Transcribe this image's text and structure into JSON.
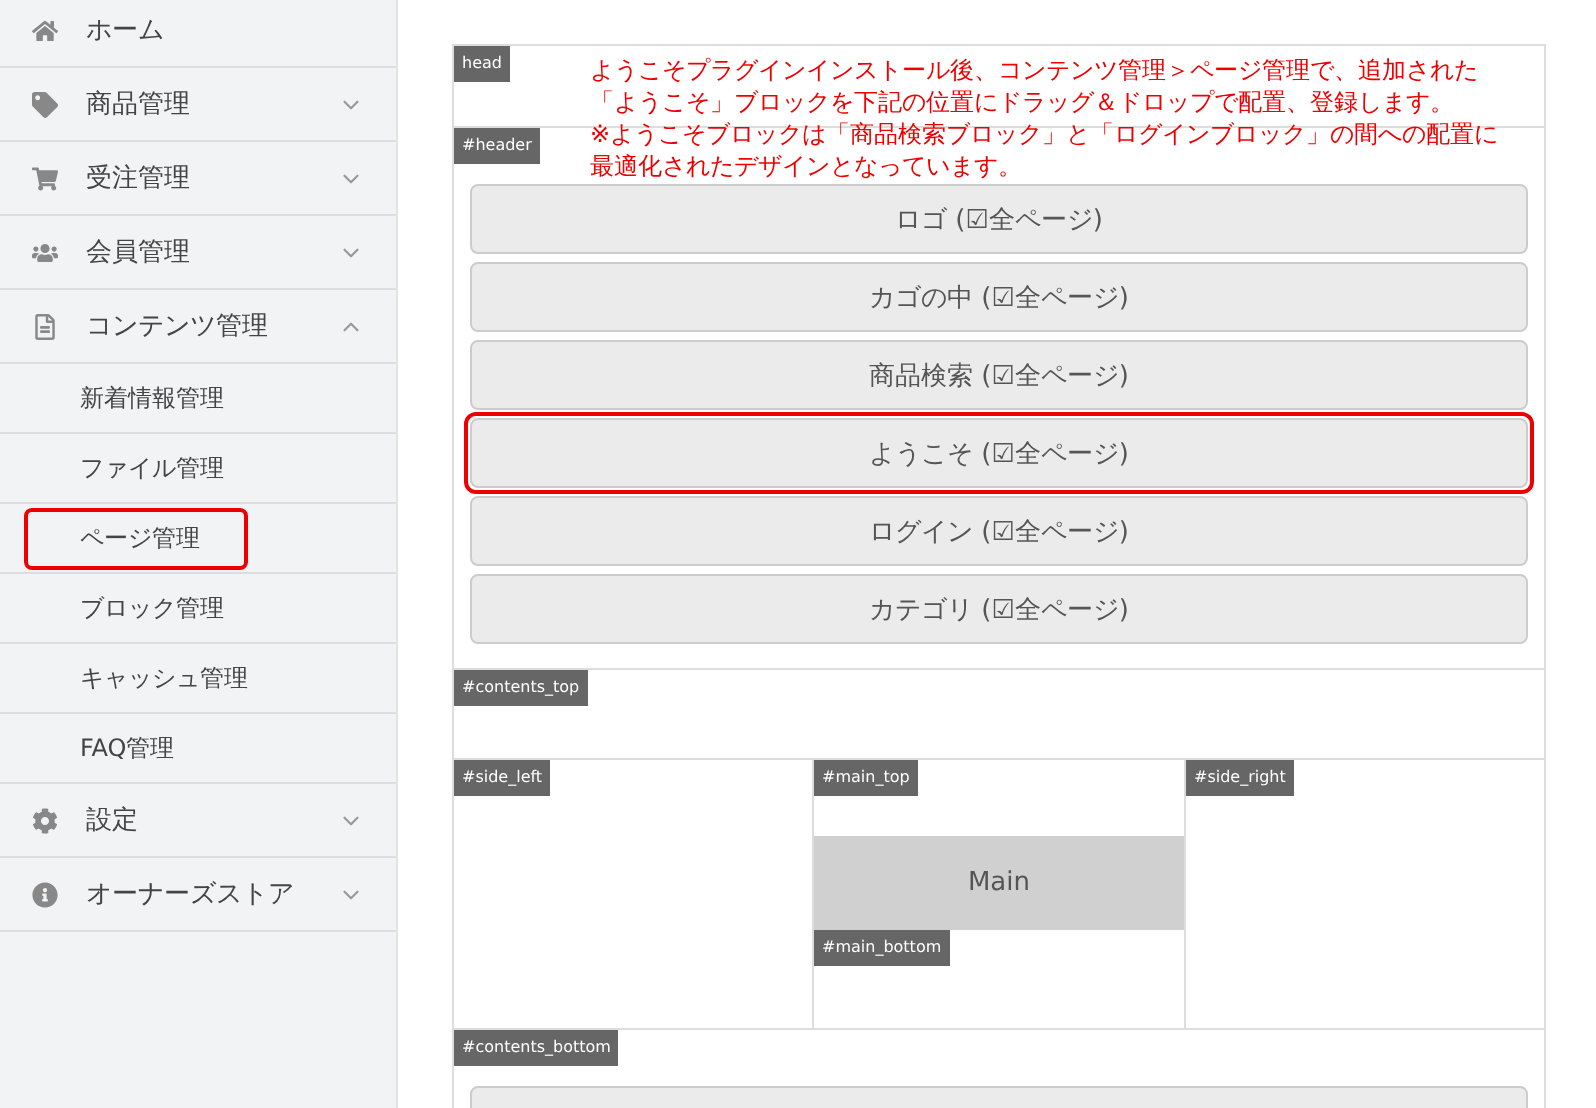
{
  "sidebar": {
    "items": [
      {
        "kind": "link",
        "label": "ホーム"
      },
      {
        "kind": "group",
        "label": "商品管理",
        "expanded": false
      },
      {
        "kind": "group",
        "label": "受注管理",
        "expanded": false
      },
      {
        "kind": "group",
        "label": "会員管理",
        "expanded": false
      },
      {
        "kind": "group",
        "label": "コンテンツ管理",
        "expanded": true,
        "children": [
          {
            "label": "新着情報管理",
            "highlighted": false
          },
          {
            "label": "ファイル管理",
            "highlighted": false
          },
          {
            "label": "ページ管理",
            "highlighted": true
          },
          {
            "label": "ブロック管理",
            "highlighted": false
          },
          {
            "label": "キャッシュ管理",
            "highlighted": false
          },
          {
            "label": "FAQ管理",
            "highlighted": false
          }
        ]
      },
      {
        "kind": "group",
        "label": "設定",
        "expanded": false
      },
      {
        "kind": "group",
        "label": "オーナーズストア",
        "expanded": false
      }
    ]
  },
  "layout": {
    "head": {
      "tag": "head"
    },
    "header": {
      "tag": "#header",
      "blocks": [
        {
          "label": "ロゴ (☑全ページ)",
          "highlighted": false
        },
        {
          "label": "カゴの中 (☑全ページ)",
          "highlighted": false
        },
        {
          "label": "商品検索 (☑全ページ)",
          "highlighted": false
        },
        {
          "label": "ようこそ (☑全ページ)",
          "highlighted": true
        },
        {
          "label": "ログイン (☑全ページ)",
          "highlighted": false
        },
        {
          "label": "カテゴリ (☑全ページ)",
          "highlighted": false
        }
      ]
    },
    "contents_top": {
      "tag": "#contents_top"
    },
    "side_left": {
      "tag": "#side_left"
    },
    "main_top": {
      "tag": "#main_top"
    },
    "main": {
      "label": "Main"
    },
    "main_bottom": {
      "tag": "#main_bottom"
    },
    "side_right": {
      "tag": "#side_right"
    },
    "contents_bottom": {
      "tag": "#contents_bottom"
    }
  },
  "annotation": {
    "paragraphs": [
      "ようこそプラグインインストール後、コンテンツ管理＞ページ管理で、追加された「ようこそ」ブロックを下記の位置にドラッグ＆ドロップで配置、登録します。",
      "※ようこそブロックは「商品検索ブロック」と「ログインブロック」の間への配置に最適化されたデザインとなっています。"
    ]
  }
}
